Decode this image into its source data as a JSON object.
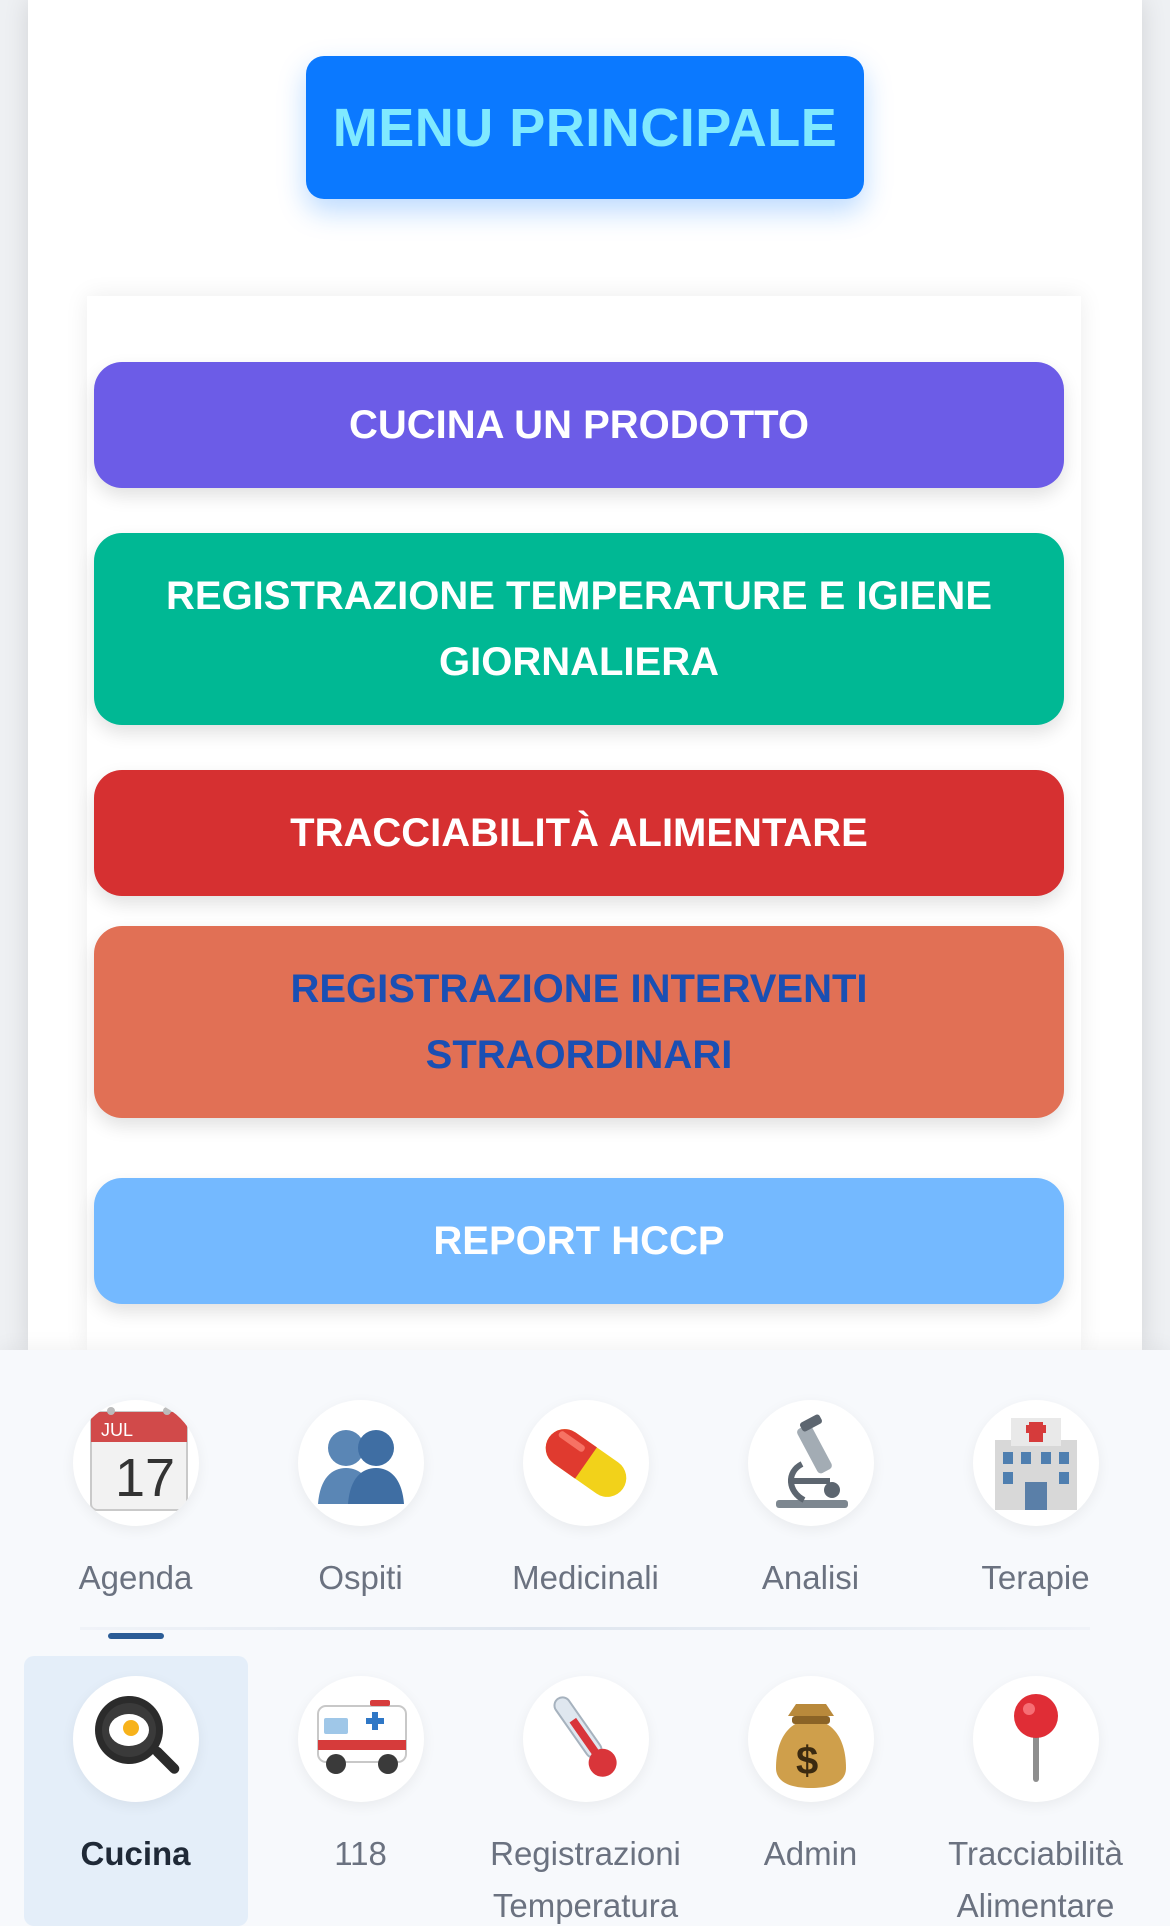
{
  "header": {
    "title": "MENU PRINCIPALE"
  },
  "actions": [
    {
      "label": "CUCINA UN PRODOTTO",
      "color": "#6c5ce7"
    },
    {
      "label": "REGISTRAZIONE TEMPERATURE E IGIENE GIORNALIERA",
      "color": "#00b894"
    },
    {
      "label": "TRACCIABILITÀ ALIMENTARE",
      "color": "#d63031"
    },
    {
      "label": "REGISTRAZIONE INTERVENTI STRAORDINARI",
      "color": "#e17055",
      "text_color": "#1a4fb3"
    },
    {
      "label": "REPORT HCCP",
      "color": "#74b9ff"
    }
  ],
  "bottom_nav": {
    "row1": [
      {
        "label": "Agenda",
        "icon": "calendar-icon",
        "calendar_month": "JUL",
        "calendar_day": "17"
      },
      {
        "label": "Ospiti",
        "icon": "users-icon"
      },
      {
        "label": "Medicinali",
        "icon": "pill-icon"
      },
      {
        "label": "Analisi",
        "icon": "microscope-icon"
      },
      {
        "label": "Terapie",
        "icon": "hospital-icon"
      }
    ],
    "row2": [
      {
        "label": "Cucina",
        "icon": "frying-pan-icon",
        "active": true
      },
      {
        "label": "118",
        "icon": "ambulance-icon"
      },
      {
        "label": "Registrazioni Temperatura",
        "icon": "thermometer-icon"
      },
      {
        "label": "Admin",
        "icon": "money-bag-icon"
      },
      {
        "label": "Tracciabilità Alimentare",
        "icon": "pushpin-icon"
      }
    ]
  },
  "colors": {
    "title_bg": "#0b79ff",
    "title_text": "#7fe9ff",
    "active_tab_bg": "#e4eef9",
    "active_indicator": "#2c5d97"
  }
}
